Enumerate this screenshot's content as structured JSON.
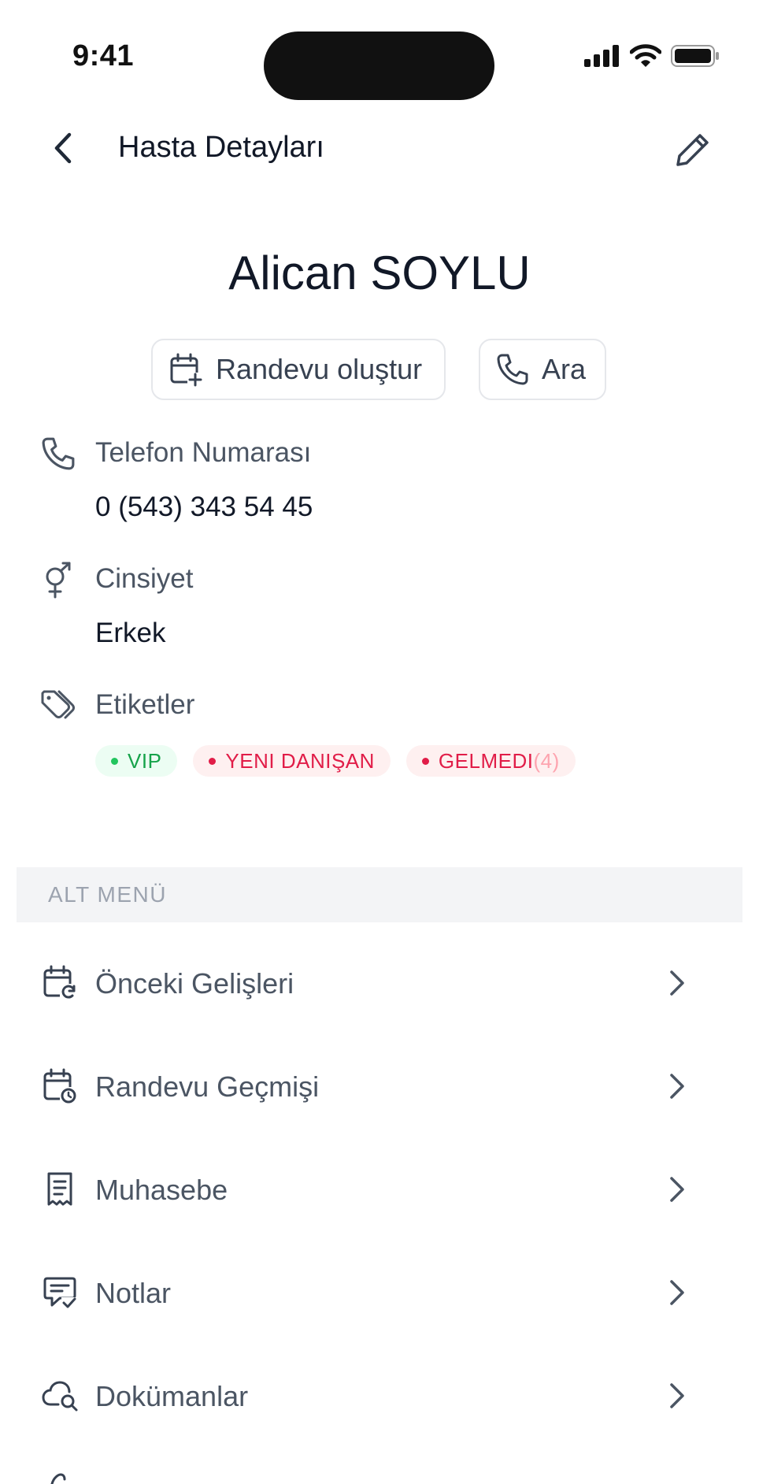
{
  "status_bar": {
    "time": "9:41"
  },
  "header": {
    "title": "Hasta Detayları"
  },
  "patient": {
    "name": "Alican SOYLU"
  },
  "actions": {
    "appointment_label": "Randevu oluştur",
    "call_label": "Ara"
  },
  "details": {
    "phone_label": "Telefon Numarası",
    "phone_value": "0 (543) 343 54 45",
    "gender_label": "Cinsiyet",
    "gender_value": "Erkek",
    "tags_label": "Etiketler"
  },
  "tags": [
    {
      "label": "VIP",
      "color": "#16a34a"
    },
    {
      "label": "YENI DANIŞAN",
      "color": "#e11d48"
    },
    {
      "label": "GELMEDI",
      "count": "(4)",
      "color": "#e11d48"
    }
  ],
  "submenu": {
    "header": "ALT MENÜ",
    "items": [
      {
        "label": "Önceki Gelişleri",
        "icon": "calendar-refresh-icon"
      },
      {
        "label": "Randevu Geçmişi",
        "icon": "calendar-clock-icon"
      },
      {
        "label": "Muhasebe",
        "icon": "receipt-icon"
      },
      {
        "label": "Notlar",
        "icon": "message-check-icon"
      },
      {
        "label": "Dokümanlar",
        "icon": "cloud-search-icon"
      }
    ]
  }
}
